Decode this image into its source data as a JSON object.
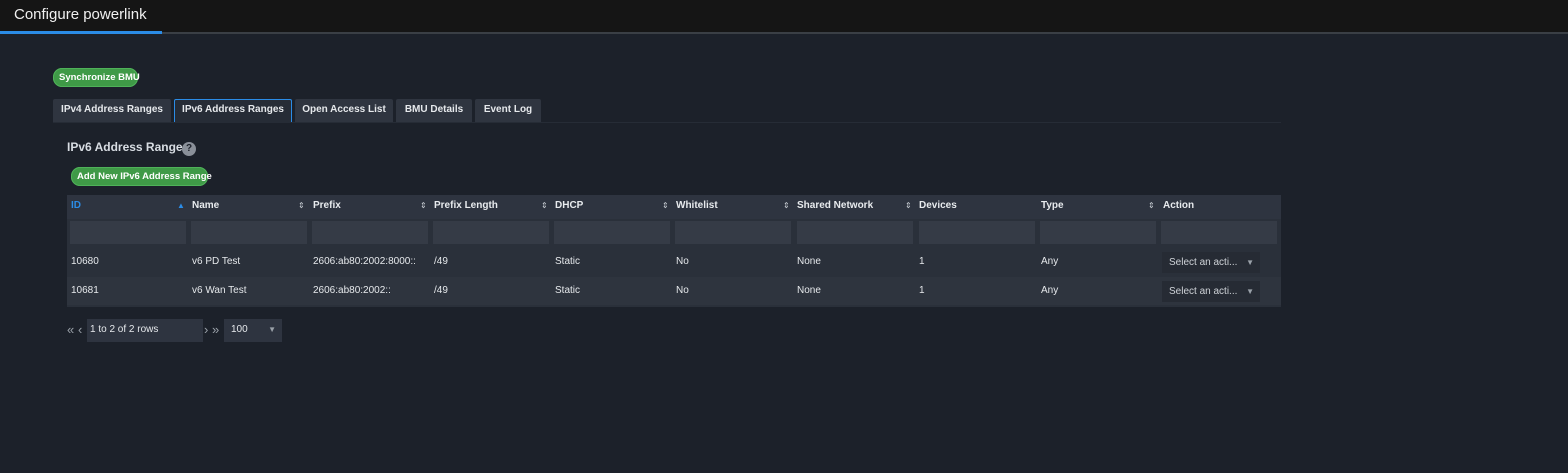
{
  "header": {
    "title": "Configure powerlink"
  },
  "sync_button": "Synchronize BMU",
  "tabs": [
    {
      "label": "IPv4 Address Ranges",
      "active": false
    },
    {
      "label": "IPv6 Address Ranges",
      "active": true
    },
    {
      "label": "Open Access List",
      "active": false
    },
    {
      "label": "BMU Details",
      "active": false
    },
    {
      "label": "Event Log",
      "active": false
    }
  ],
  "section": {
    "title": "IPv6 Address Ranges",
    "help_icon": "question-circle-icon",
    "add_button": "Add New IPv6 Address Range"
  },
  "table": {
    "columns": [
      "ID",
      "Name",
      "Prefix",
      "Prefix Length",
      "DHCP",
      "Whitelist",
      "Shared Network",
      "Devices",
      "Type",
      "Action"
    ],
    "sorted_column": "ID",
    "sort_direction": "asc",
    "rows": [
      {
        "id": "10680",
        "name": "v6 PD Test",
        "prefix": "2606:ab80:2002:8000::",
        "prefix_length": "/49",
        "dhcp": "Static",
        "whitelist": "No",
        "shared_network": "None",
        "devices": "1",
        "type": "Any",
        "action": "Select an acti..."
      },
      {
        "id": "10681",
        "name": "v6 Wan Test",
        "prefix": "2606:ab80:2002::",
        "prefix_length": "/49",
        "dhcp": "Static",
        "whitelist": "No",
        "shared_network": "None",
        "devices": "1",
        "type": "Any",
        "action": "Select an acti..."
      }
    ]
  },
  "pager": {
    "info": "1 to 2 of 2 rows",
    "page_size": "100"
  },
  "colors": {
    "accent": "#2b8ce6",
    "green": "#3f9a47",
    "background": "#1c212a"
  }
}
